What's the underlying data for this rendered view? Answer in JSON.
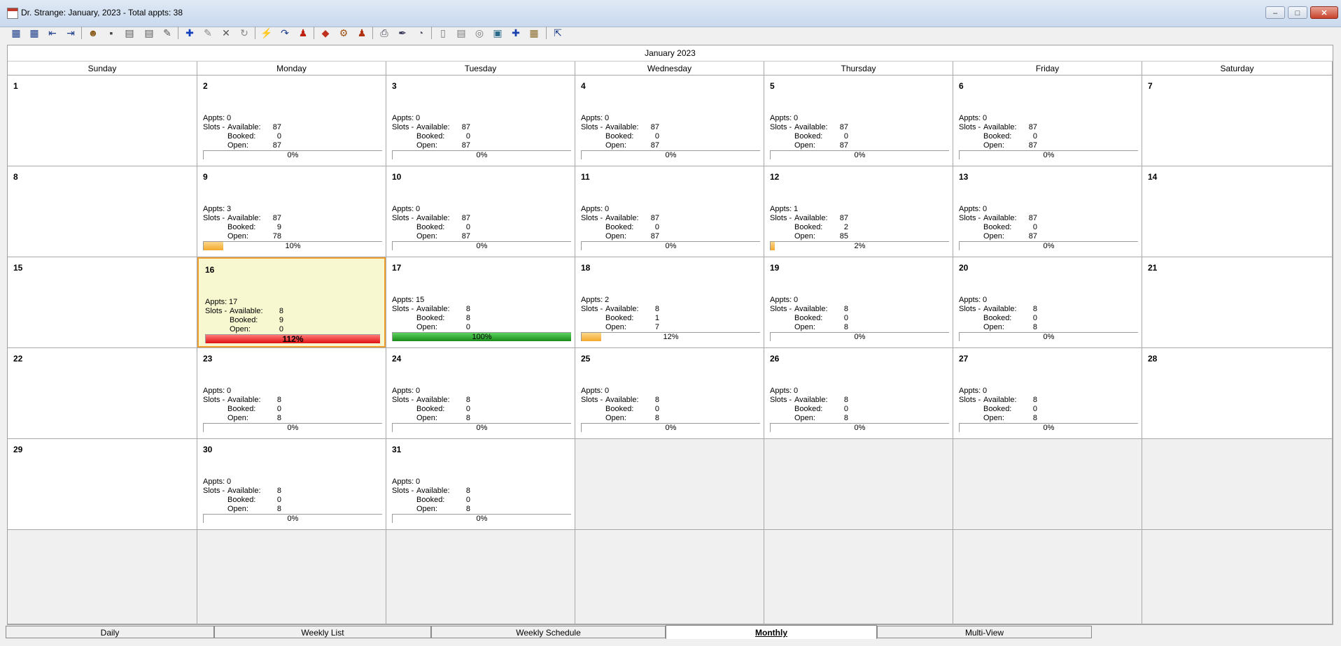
{
  "window": {
    "title": "Dr. Strange: January, 2023 - Total appts: 38",
    "minimize": "–",
    "maximize": "□",
    "close": "✕"
  },
  "toolbar": {
    "icons": [
      "daily-view-icon",
      "weekly-view-icon",
      "previous-icon",
      "next-icon",
      "patient-icon",
      "find-slot-icon",
      "template-icon",
      "schedule-report-icon",
      "schedule-edit-icon",
      "add-appointment-icon",
      "edit-appointment-icon",
      "delete-icon",
      "reschedule-icon",
      "lightning-icon",
      "redo-icon",
      "provider-icon",
      "eraser-icon",
      "settings-icon",
      "user-icon",
      "print-icon",
      "pen-icon",
      "preview-icon",
      "document-icon",
      "notes-icon",
      "globe-icon",
      "display-icon",
      "medical-cross-icon",
      "calendar-picker-icon",
      "exit-icon"
    ]
  },
  "calendar": {
    "month_title": "January 2023",
    "weekdays": [
      "Sunday",
      "Monday",
      "Tuesday",
      "Wednesday",
      "Thursday",
      "Friday",
      "Saturday"
    ],
    "labels": {
      "appts": "Appts:",
      "slots": "Slots -",
      "available": "Available:",
      "booked": "Booked:",
      "open": "Open:"
    },
    "days": [
      {
        "date": "1"
      },
      {
        "date": "2",
        "appts": "0",
        "available": "87",
        "booked": "0",
        "open": "87",
        "percent_label": "0%",
        "fill_fraction": 0,
        "fill": "none"
      },
      {
        "date": "3",
        "appts": "0",
        "available": "87",
        "booked": "0",
        "open": "87",
        "percent_label": "0%",
        "fill_fraction": 0,
        "fill": "none"
      },
      {
        "date": "4",
        "appts": "0",
        "available": "87",
        "booked": "0",
        "open": "87",
        "percent_label": "0%",
        "fill_fraction": 0,
        "fill": "none"
      },
      {
        "date": "5",
        "appts": "0",
        "available": "87",
        "booked": "0",
        "open": "87",
        "percent_label": "0%",
        "fill_fraction": 0,
        "fill": "none"
      },
      {
        "date": "6",
        "appts": "0",
        "available": "87",
        "booked": "0",
        "open": "87",
        "percent_label": "0%",
        "fill_fraction": 0,
        "fill": "none"
      },
      {
        "date": "7"
      },
      {
        "date": "8"
      },
      {
        "date": "9",
        "appts": "3",
        "available": "87",
        "booked": "9",
        "open": "78",
        "percent_label": "10%",
        "fill_fraction": 0.1,
        "fill": "orange"
      },
      {
        "date": "10",
        "appts": "0",
        "available": "87",
        "booked": "0",
        "open": "87",
        "percent_label": "0%",
        "fill_fraction": 0,
        "fill": "none"
      },
      {
        "date": "11",
        "appts": "0",
        "available": "87",
        "booked": "0",
        "open": "87",
        "percent_label": "0%",
        "fill_fraction": 0,
        "fill": "none"
      },
      {
        "date": "12",
        "appts": "1",
        "available": "87",
        "booked": "2",
        "open": "85",
        "percent_label": "2%",
        "fill_fraction": 0.02,
        "fill": "orange"
      },
      {
        "date": "13",
        "appts": "0",
        "available": "87",
        "booked": "0",
        "open": "87",
        "percent_label": "0%",
        "fill_fraction": 0,
        "fill": "none"
      },
      {
        "date": "14"
      },
      {
        "date": "15"
      },
      {
        "date": "16",
        "appts": "17",
        "available": "8",
        "booked": "9",
        "open": "0",
        "percent_label": "112%",
        "fill_fraction": 1,
        "fill": "red",
        "today": true
      },
      {
        "date": "17",
        "appts": "15",
        "available": "8",
        "booked": "8",
        "open": "0",
        "percent_label": "100%",
        "fill_fraction": 1,
        "fill": "green"
      },
      {
        "date": "18",
        "appts": "2",
        "available": "8",
        "booked": "1",
        "open": "7",
        "percent_label": "12%",
        "fill_fraction": 0.12,
        "fill": "orange"
      },
      {
        "date": "19",
        "appts": "0",
        "available": "8",
        "booked": "0",
        "open": "8",
        "percent_label": "0%",
        "fill_fraction": 0,
        "fill": "none"
      },
      {
        "date": "20",
        "appts": "0",
        "available": "8",
        "booked": "0",
        "open": "8",
        "percent_label": "0%",
        "fill_fraction": 0,
        "fill": "none"
      },
      {
        "date": "21"
      },
      {
        "date": "22"
      },
      {
        "date": "23",
        "appts": "0",
        "available": "8",
        "booked": "0",
        "open": "8",
        "percent_label": "0%",
        "fill_fraction": 0,
        "fill": "none"
      },
      {
        "date": "24",
        "appts": "0",
        "available": "8",
        "booked": "0",
        "open": "8",
        "percent_label": "0%",
        "fill_fraction": 0,
        "fill": "none"
      },
      {
        "date": "25",
        "appts": "0",
        "available": "8",
        "booked": "0",
        "open": "8",
        "percent_label": "0%",
        "fill_fraction": 0,
        "fill": "none"
      },
      {
        "date": "26",
        "appts": "0",
        "available": "8",
        "booked": "0",
        "open": "8",
        "percent_label": "0%",
        "fill_fraction": 0,
        "fill": "none"
      },
      {
        "date": "27",
        "appts": "0",
        "available": "8",
        "booked": "0",
        "open": "8",
        "percent_label": "0%",
        "fill_fraction": 0,
        "fill": "none"
      },
      {
        "date": "28"
      },
      {
        "date": "29"
      },
      {
        "date": "30",
        "appts": "0",
        "available": "8",
        "booked": "0",
        "open": "8",
        "percent_label": "0%",
        "fill_fraction": 0,
        "fill": "none"
      },
      {
        "date": "31",
        "appts": "0",
        "available": "8",
        "booked": "0",
        "open": "8",
        "percent_label": "0%",
        "fill_fraction": 0,
        "fill": "none"
      },
      {},
      {},
      {},
      {},
      {},
      {},
      {},
      {},
      {},
      {},
      {}
    ]
  },
  "tabs": [
    {
      "label": "Daily",
      "underline": "D",
      "active": false
    },
    {
      "label": "Weekly List",
      "underline": "L",
      "active": false
    },
    {
      "label": "Weekly Schedule",
      "underline": "S",
      "active": false
    },
    {
      "label": "Monthly",
      "underline": "M",
      "active": true
    },
    {
      "label": "Multi-View",
      "underline": "V",
      "active": false
    }
  ],
  "colors": {
    "today_border": "#f0a030",
    "today_bg": "#f7f7d0",
    "bar_orange": "#f2a92b",
    "bar_red": "#e01010",
    "bar_green": "#1a8a1a"
  }
}
